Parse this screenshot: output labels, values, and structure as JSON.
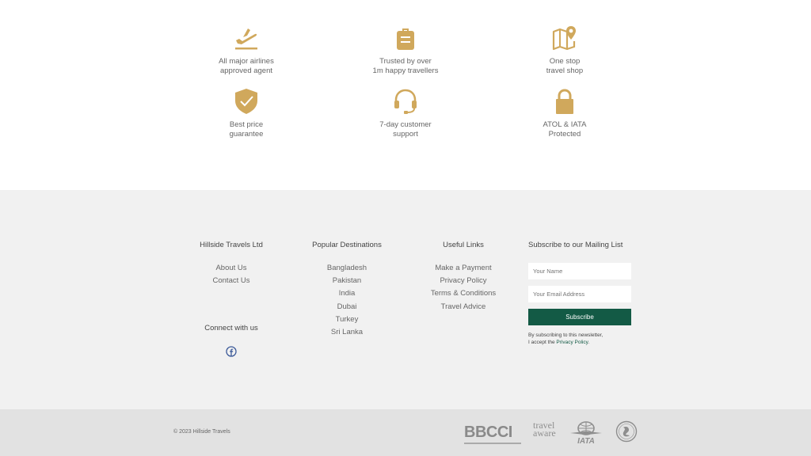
{
  "features": [
    {
      "icon": "plane-takeoff-icon",
      "line1": "All major airlines",
      "line2": "approved agent"
    },
    {
      "icon": "luggage-icon",
      "line1": "Trusted by over",
      "line2": "1m happy travellers"
    },
    {
      "icon": "map-pin-icon",
      "line1": "One stop",
      "line2": "travel shop"
    },
    {
      "icon": "shield-check-icon",
      "line1": "Best price",
      "line2": "guarantee"
    },
    {
      "icon": "headset-icon",
      "line1": "7-day customer",
      "line2": "support"
    },
    {
      "icon": "padlock-icon",
      "line1": "ATOL & IATA",
      "line2": "Protected"
    }
  ],
  "footer": {
    "company": {
      "title": "Hillside Travels Ltd",
      "links": [
        "About Us",
        "Contact Us"
      ],
      "connect": "Connect with us"
    },
    "destinations": {
      "title": "Popular Destinations",
      "links": [
        "Bangladesh",
        "Pakistan",
        "India",
        "Dubai",
        "Turkey",
        "Sri Lanka"
      ]
    },
    "useful": {
      "title": "Useful Links",
      "links": [
        "Make a Payment",
        "Privacy Policy",
        "Terms & Conditions",
        "Travel Advice"
      ]
    },
    "subscribe": {
      "title": "Subscribe to our Mailing List",
      "name_placeholder": "Your Name",
      "email_placeholder": "Your Email Address",
      "button": "Subscribe",
      "note_line1": "By subscribing to this newsletter,",
      "note_line2_prefix": "I accept the ",
      "note_link": "Privacy Policy",
      "note_suffix": "."
    }
  },
  "bottom": {
    "copyright": "© 2023 Hillside Travels",
    "logos": {
      "bbcci": "BBCCI",
      "travel_aware_1": "travel",
      "travel_aware_2": "aware",
      "iata": "IATA"
    }
  },
  "colors": {
    "gold": "#d0a85c",
    "green": "#135a45",
    "facebook": "#3b5998"
  }
}
